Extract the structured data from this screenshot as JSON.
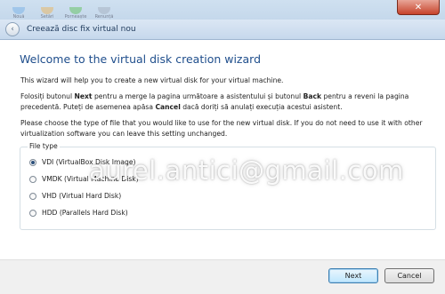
{
  "background_app": {
    "toolbar": [
      {
        "label": "Nouă",
        "icon": "new-icon",
        "color": "#7fb5e8"
      },
      {
        "label": "Setări",
        "icon": "settings-icon",
        "color": "#e8b86a"
      },
      {
        "label": "Porneaște",
        "icon": "start-icon",
        "color": "#6bc46b"
      },
      {
        "label": "Renunță",
        "icon": "discard-icon",
        "color": "#a8b4c4"
      }
    ],
    "close_glyph": "✕"
  },
  "dialog": {
    "title": "Creează disc fix virtual nou",
    "back_glyph": "‹",
    "heading": "Welcome to the virtual disk creation wizard",
    "intro": "This wizard will help you to create a new virtual disk for your virtual machine.",
    "para2": {
      "t1": "Folosiți butonul ",
      "next": "Next",
      "t2": " pentru a merge la pagina următoare a asistentului și butonul ",
      "back": "Back",
      "t3": " pentru a reveni la pagina precedentă. Puteți de asemenea apăsa ",
      "cancel": "Cancel",
      "t4": " dacă doriți să anulați execuția acestui asistent."
    },
    "para3": "Please choose the type of file that you would like to use for the new virtual disk. If you do not need to use it with other virtualization software you can leave this setting unchanged.",
    "group_label": "File type",
    "options": [
      {
        "label": "VDI (VirtualBox Disk Image)",
        "selected": true
      },
      {
        "label": "VMDK (Virtual Machine Disk)",
        "selected": false
      },
      {
        "label": "VHD (Virtual Hard Disk)",
        "selected": false
      },
      {
        "label": "HDD (Parallels Hard Disk)",
        "selected": false
      }
    ],
    "watermark": "aurel.antici@gmail.com",
    "buttons": {
      "next": "Next",
      "cancel": "Cancel"
    }
  }
}
